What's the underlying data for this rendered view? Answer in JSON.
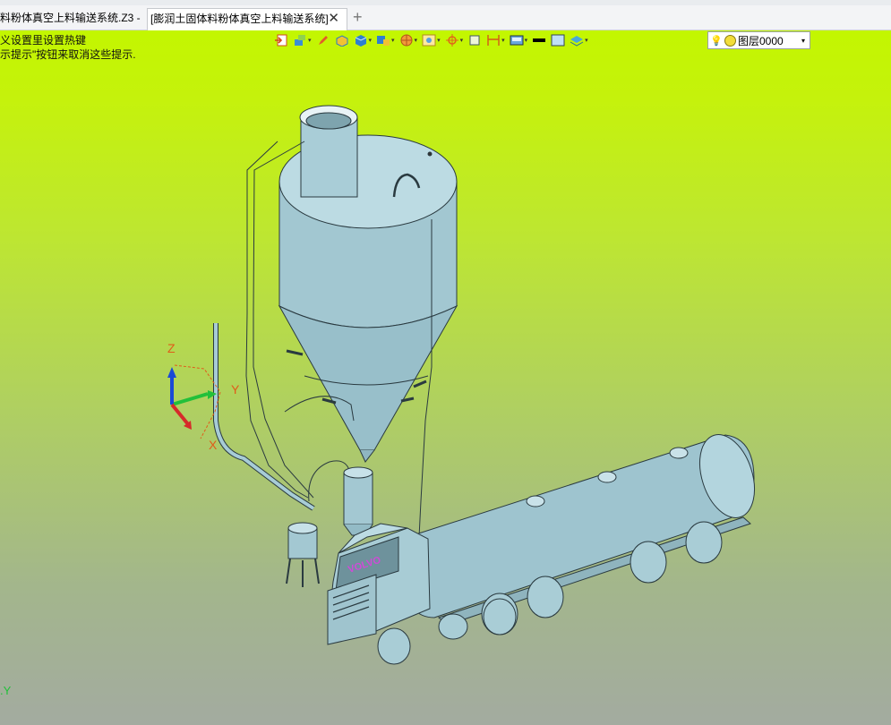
{
  "tabs": [
    {
      "label": "料粉体真空上料输送系统.Z3 -"
    },
    {
      "label": "[膨润土固体料粉体真空上料输送系统]"
    }
  ],
  "tab_close_glyph": "✕",
  "tab_add_glyph": "+",
  "hints": {
    "line1": "义设置里设置热键",
    "line2": "示提示\"按钮来取消这些提示."
  },
  "toolbar_icons": [
    "exit-sketch-icon",
    "assembly-icon",
    "pencil-icon",
    "part-icon",
    "solid-box-icon",
    "insert-part-icon",
    "wheel-icon",
    "view-icon",
    "datum-icon",
    "sheet-icon",
    "dimension-icon",
    "display-mode-icon",
    "line-color-icon",
    "face-color-icon",
    "layer-stack-icon"
  ],
  "layer": {
    "name": "图层0000",
    "dropdown_glyph": "▾",
    "bulb_glyph": "💡"
  },
  "axes": {
    "z": "Z",
    "y": "Y",
    "x": "X"
  },
  "corner_axis": {
    "label": "Y",
    "prefix": "."
  },
  "truck": {
    "nameplate": "VOLVO"
  },
  "colors": {
    "model": "#9fc5cf",
    "model_dark": "#7fa7b1",
    "bg_top": "#c3f600",
    "bg_bottom": "#a3aba0"
  }
}
